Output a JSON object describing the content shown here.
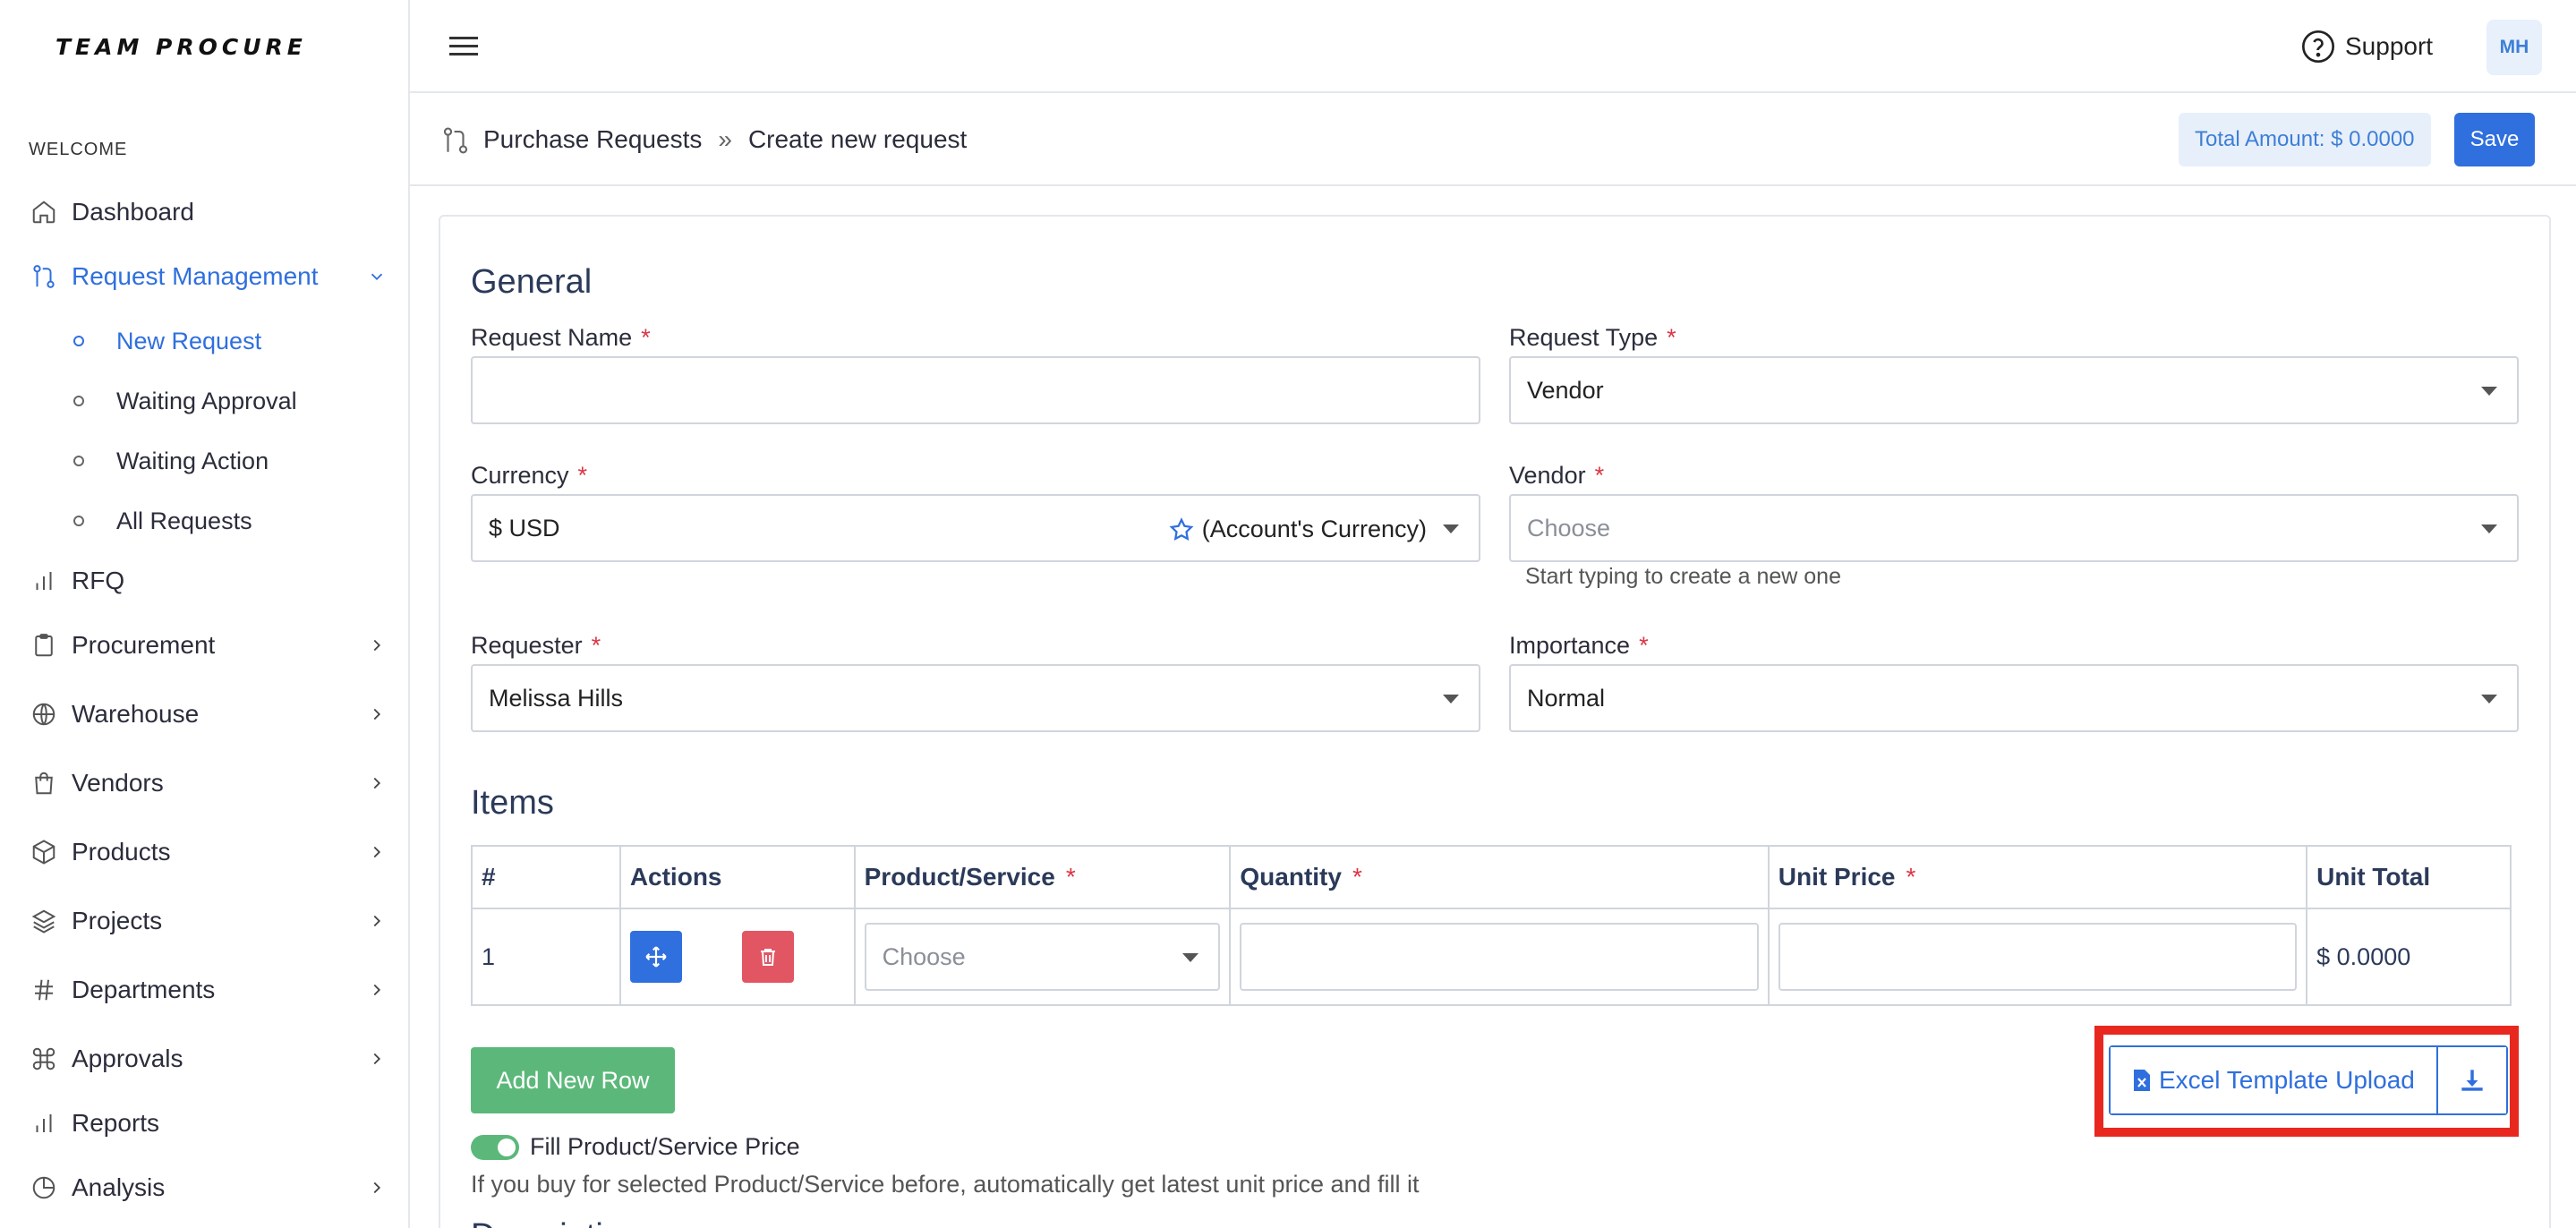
{
  "brand": {
    "logo": "TEAM PROCURE"
  },
  "sidebar": {
    "welcome": "WELCOME",
    "items": [
      {
        "label": "Dashboard",
        "icon": "home-icon"
      },
      {
        "label": "Request Management",
        "icon": "git-pull-icon"
      },
      {
        "label": "RFQ",
        "icon": "bar-chart-icon"
      },
      {
        "label": "Procurement",
        "icon": "clipboard-icon"
      },
      {
        "label": "Warehouse",
        "icon": "globe-icon"
      },
      {
        "label": "Vendors",
        "icon": "shopping-bag-icon"
      },
      {
        "label": "Products",
        "icon": "box-icon"
      },
      {
        "label": "Projects",
        "icon": "layers-icon"
      },
      {
        "label": "Departments",
        "icon": "hash-icon"
      },
      {
        "label": "Approvals",
        "icon": "command-icon"
      },
      {
        "label": "Reports",
        "icon": "bar-chart-icon"
      },
      {
        "label": "Analysis",
        "icon": "pie-chart-icon"
      }
    ],
    "sub_items": [
      {
        "label": "New Request"
      },
      {
        "label": "Waiting Approval"
      },
      {
        "label": "Waiting Action"
      },
      {
        "label": "All Requests"
      }
    ]
  },
  "topbar": {
    "support": "Support",
    "avatar": "MH"
  },
  "breadcrumb": {
    "parent": "Purchase Requests",
    "separator": "»",
    "current": "Create new request"
  },
  "header": {
    "total": "Total Amount: $ 0.0000",
    "save": "Save"
  },
  "general": {
    "title": "General",
    "required_mark": "*",
    "request_name": {
      "label": "Request Name",
      "value": ""
    },
    "request_type": {
      "label": "Request Type",
      "value": "Vendor"
    },
    "currency": {
      "label": "Currency",
      "value": "$ USD",
      "suffix": "(Account's Currency)"
    },
    "vendor": {
      "label": "Vendor",
      "placeholder": "Choose",
      "hint": "Start typing to create a new one"
    },
    "requester": {
      "label": "Requester",
      "value": "Melissa Hills"
    },
    "importance": {
      "label": "Importance",
      "value": "Normal"
    }
  },
  "items": {
    "title": "Items",
    "columns": [
      "#",
      "Actions",
      "Product/Service",
      "Quantity",
      "Unit Price",
      "Unit Total"
    ],
    "rows": [
      {
        "index": "1",
        "product_placeholder": "Choose",
        "quantity": "",
        "unit_price": "",
        "unit_total": "$ 0.0000"
      }
    ],
    "add_row": "Add New Row",
    "fill_price_label": "Fill Product/Service Price",
    "fill_price_enabled": true,
    "fill_price_hint": "If you buy for selected Product/Service before, automatically get latest unit price and fill it",
    "excel_upload": "Excel Template Upload",
    "next_section_partial": "Description"
  },
  "colors": {
    "accent": "#2f6fde",
    "success": "#5cb87a",
    "danger": "#e25563",
    "highlight": "#e8281f"
  }
}
